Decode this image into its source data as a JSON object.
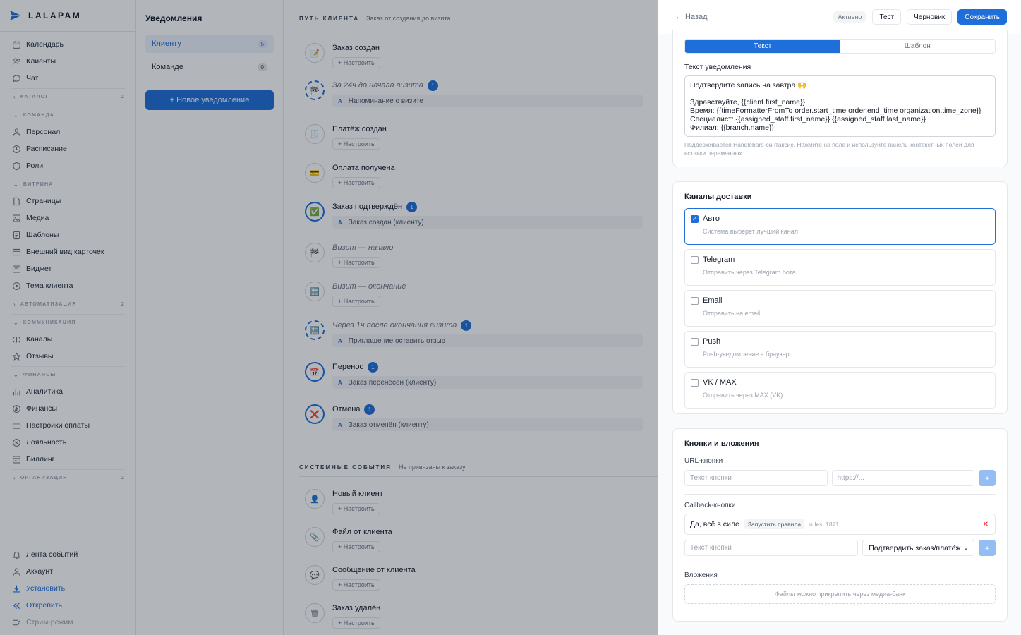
{
  "brand": "LALAPAM",
  "sidebar": {
    "top_items": [
      {
        "label": "Календарь",
        "icon": "calendar-icon"
      },
      {
        "label": "Клиенты",
        "icon": "users-icon"
      },
      {
        "label": "Чат",
        "icon": "chat-icon"
      }
    ],
    "sections": [
      {
        "title": "КАТАЛОГ",
        "count": "2",
        "collapsed": true,
        "items": []
      },
      {
        "title": "КОМАНДА",
        "count": "",
        "collapsed": false,
        "items": [
          {
            "label": "Персонал",
            "icon": "user-icon"
          },
          {
            "label": "Расписание",
            "icon": "clock-icon"
          },
          {
            "label": "Роли",
            "icon": "shield-icon"
          }
        ]
      },
      {
        "title": "ВИТРИНА",
        "count": "",
        "collapsed": false,
        "items": [
          {
            "label": "Страницы",
            "icon": "page-icon"
          },
          {
            "label": "Медиа",
            "icon": "image-icon"
          },
          {
            "label": "Шаблоны",
            "icon": "template-icon"
          },
          {
            "label": "Внешний вид карточек",
            "icon": "card-icon"
          },
          {
            "label": "Виджет",
            "icon": "widget-icon"
          },
          {
            "label": "Тема клиента",
            "icon": "palette-icon"
          }
        ]
      },
      {
        "title": "АВТОМАТИЗАЦИЯ",
        "count": "2",
        "collapsed": true,
        "items": []
      },
      {
        "title": "КОММУНИКАЦИЯ",
        "count": "",
        "collapsed": false,
        "items": [
          {
            "label": "Каналы",
            "icon": "channels-icon"
          },
          {
            "label": "Отзывы",
            "icon": "star-icon"
          }
        ]
      },
      {
        "title": "ФИНАНСЫ",
        "count": "",
        "collapsed": false,
        "items": [
          {
            "label": "Аналитика",
            "icon": "analytics-icon"
          },
          {
            "label": "Финансы",
            "icon": "coin-icon"
          },
          {
            "label": "Настройки оплаты",
            "icon": "payment-icon"
          },
          {
            "label": "Лояльность",
            "icon": "loyalty-icon"
          },
          {
            "label": "Биллинг",
            "icon": "billing-icon"
          }
        ]
      },
      {
        "title": "ОРГАНИЗАЦИЯ",
        "count": "2",
        "collapsed": true,
        "items": []
      }
    ],
    "bottom_items": [
      {
        "label": "Лента событий",
        "icon": "bell-icon"
      },
      {
        "label": "Аккаунт",
        "icon": "account-icon"
      },
      {
        "label": "Установить",
        "icon": "download-icon"
      },
      {
        "label": "Открепить",
        "icon": "unpin-icon"
      },
      {
        "label": "Стрим-режим",
        "icon": "stream-icon"
      }
    ]
  },
  "notifications": {
    "title": "Уведомления",
    "audiences": [
      {
        "label": "Клиенту",
        "count": "5"
      },
      {
        "label": "Команде",
        "count": "0"
      }
    ],
    "new_button": "+ Новое уведомление"
  },
  "timeline": {
    "journey": {
      "title": "ПУТЬ КЛИЕНТА",
      "subtitle": "Заказ от создания до визита"
    },
    "system": {
      "title": "СИСТЕМНЫЕ СОБЫТИЯ",
      "subtitle": "Не привязаны к заказу"
    },
    "configure_label": "+ Настроить",
    "events": [
      {
        "title": "Заказ создан",
        "icon": "📝",
        "badge": "",
        "rule": "",
        "italic": false,
        "state": "off"
      },
      {
        "title": "За 24ч до начала визита",
        "icon": "🏁",
        "badge": "1",
        "rule": "Напоминание о визите",
        "italic": true,
        "state": "dash"
      },
      {
        "title": "Платёж создан",
        "icon": "🧾",
        "badge": "",
        "rule": "",
        "italic": false,
        "state": "off"
      },
      {
        "title": "Оплата получена",
        "icon": "💳",
        "badge": "",
        "rule": "",
        "italic": false,
        "state": "off"
      },
      {
        "title": "Заказ подтверждён",
        "icon": "✅",
        "badge": "1",
        "rule": "Заказ создан (клиенту)",
        "italic": false,
        "state": "on"
      },
      {
        "title": "Визит — начало",
        "icon": "🏁",
        "badge": "",
        "rule": "",
        "italic": true,
        "state": "off"
      },
      {
        "title": "Визит — окончание",
        "icon": "🔚",
        "badge": "",
        "rule": "",
        "italic": true,
        "state": "off"
      },
      {
        "title": "Через 1ч после окончания визита",
        "icon": "🔚",
        "badge": "1",
        "rule": "Приглашение оставить отзыв",
        "italic": true,
        "state": "dash"
      },
      {
        "title": "Перенос",
        "icon": "📅",
        "badge": "1",
        "rule": "Заказ перенесён (клиенту)",
        "italic": false,
        "state": "on"
      },
      {
        "title": "Отмена",
        "icon": "❌",
        "badge": "1",
        "rule": "Заказ отменён (клиенту)",
        "italic": false,
        "state": "on"
      }
    ],
    "system_events": [
      {
        "title": "Новый клиент",
        "icon": "👤"
      },
      {
        "title": "Файл от клиента",
        "icon": "📎"
      },
      {
        "title": "Сообщение от клиента",
        "icon": "💬"
      },
      {
        "title": "Заказ удалён",
        "icon": "🗑"
      }
    ]
  },
  "panel": {
    "back": "← Назад",
    "status": "Активно",
    "test": "Тест",
    "draft": "Черновик",
    "save": "Сохранить",
    "tabs": [
      "Текст",
      "Шаблон"
    ],
    "text_label": "Текст уведомления",
    "text_value": "Подтвердите запись на завтра 🙌\n\nЗдравствуйте, {{client.first_name}}!\nВремя: {{timeFormatterFromTo order.start_time order.end_time organization.time_zone}}\nСпециалист: {{assigned_staff.first_name}} {{assigned_staff.last_name}}\nФилиал: {{branch.name}}",
    "text_hint": "Поддерживается Handlebars-синтаксис. Нажмите на поле и используйте панель контекстных полей для вставки переменных.",
    "channels_title": "Каналы доставки",
    "channels": [
      {
        "name": "Авто",
        "desc": "Система выберет лучший канал",
        "checked": true
      },
      {
        "name": "Telegram",
        "desc": "Отправить через Telegram бота",
        "checked": false
      },
      {
        "name": "Email",
        "desc": "Отправить на email",
        "checked": false
      },
      {
        "name": "Push",
        "desc": "Push-уведомление в браузер",
        "checked": false
      },
      {
        "name": "VK / MAX",
        "desc": "Отправить через MAX (VK)",
        "checked": false
      }
    ],
    "buttons_title": "Кнопки и вложения",
    "url_buttons_label": "URL-кнопки",
    "button_text_placeholder": "Текст кнопки",
    "url_placeholder": "https://...",
    "callback_label": "Callback-кнопки",
    "callback_item": {
      "name": "Да, всё в силе",
      "tag": "Запустить правила",
      "rules": "rules: 1871"
    },
    "callback_select": "Подтвердить заказ/платёж",
    "attachments_label": "Вложения",
    "attachments_hint": "Файлы можно прикрепить через медиа-банк"
  }
}
